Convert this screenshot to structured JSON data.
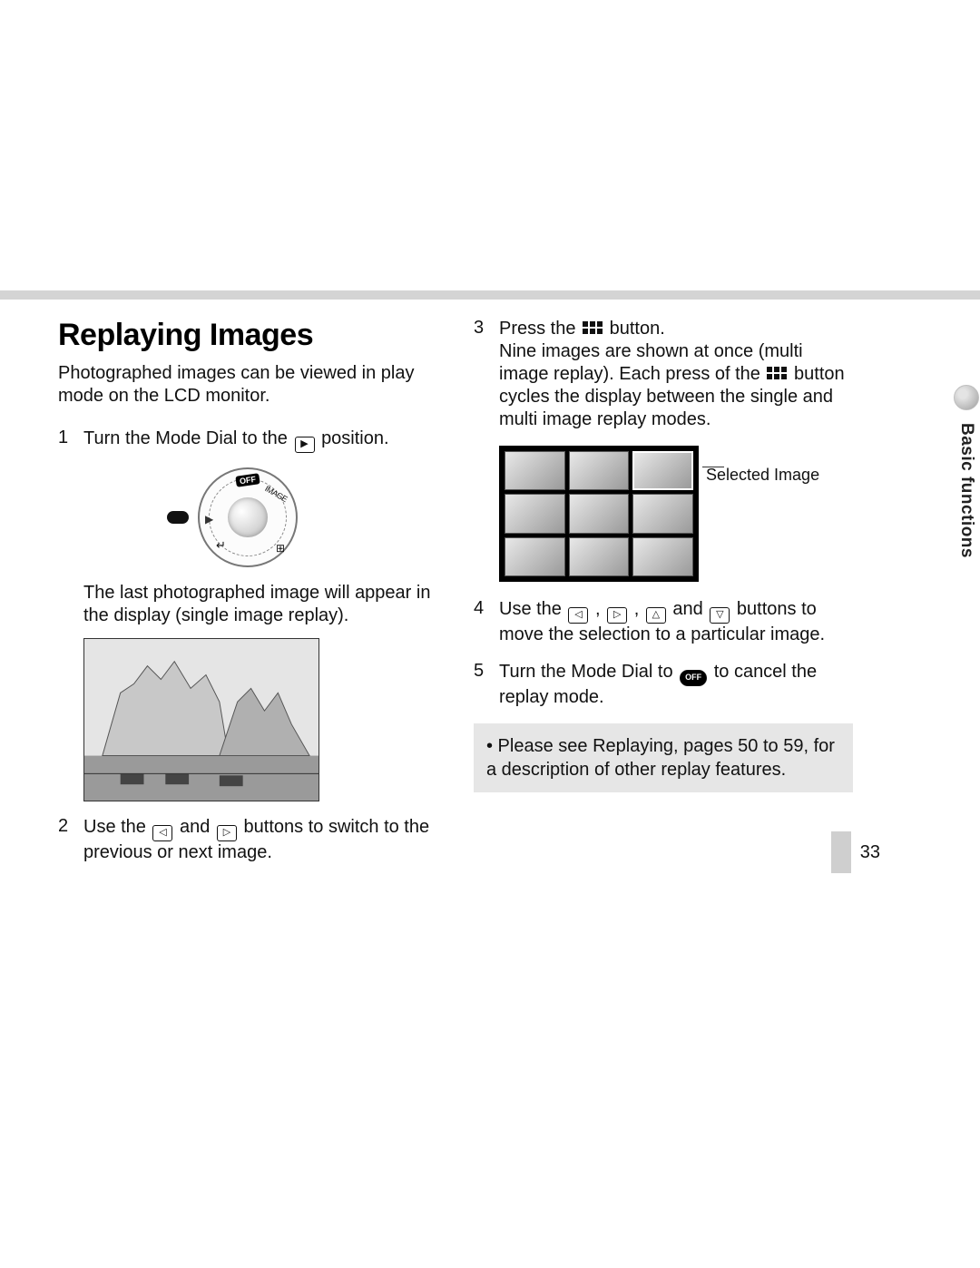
{
  "title": "Replaying Images",
  "intro": "Photographed images can be viewed in play mode on the LCD monitor.",
  "steps": {
    "s1_num": "1",
    "s1_a": "Turn the Mode Dial to the ",
    "s1_b": " position.",
    "s1_sub": "The last photographed image will appear in the display (single image replay).",
    "s2_num": "2",
    "s2_a": "Use the ",
    "s2_b": " and ",
    "s2_c": " buttons to switch to the previous or next image.",
    "s3_num": "3",
    "s3_a": "Press the ",
    "s3_b": " button.",
    "s3_sub_a": "Nine images are shown at once (multi image replay). Each press of the ",
    "s3_sub_b": " button cycles the display between the single and multi image replay modes.",
    "s4_num": "4",
    "s4_a": "Use the ",
    "s4_comma": " , ",
    "s4_comma2": ", ",
    "s4_and": " and ",
    "s4_b": " buttons to move the selection to a particular image.",
    "s5_num": "5",
    "s5_a": "Turn the Mode Dial to ",
    "s5_b": " to cancel the replay mode."
  },
  "dial": {
    "off": "OFF",
    "image": "IMAGE",
    "play": "▶",
    "stitch": "⊞",
    "arrow": "↵"
  },
  "offLabel": "OFF",
  "callout": "Selected\nImage",
  "note": "• Please see Replaying, pages 50 to 59, for a description of other replay features.",
  "sideLabel": "Basic functions",
  "pageNumber": "33"
}
